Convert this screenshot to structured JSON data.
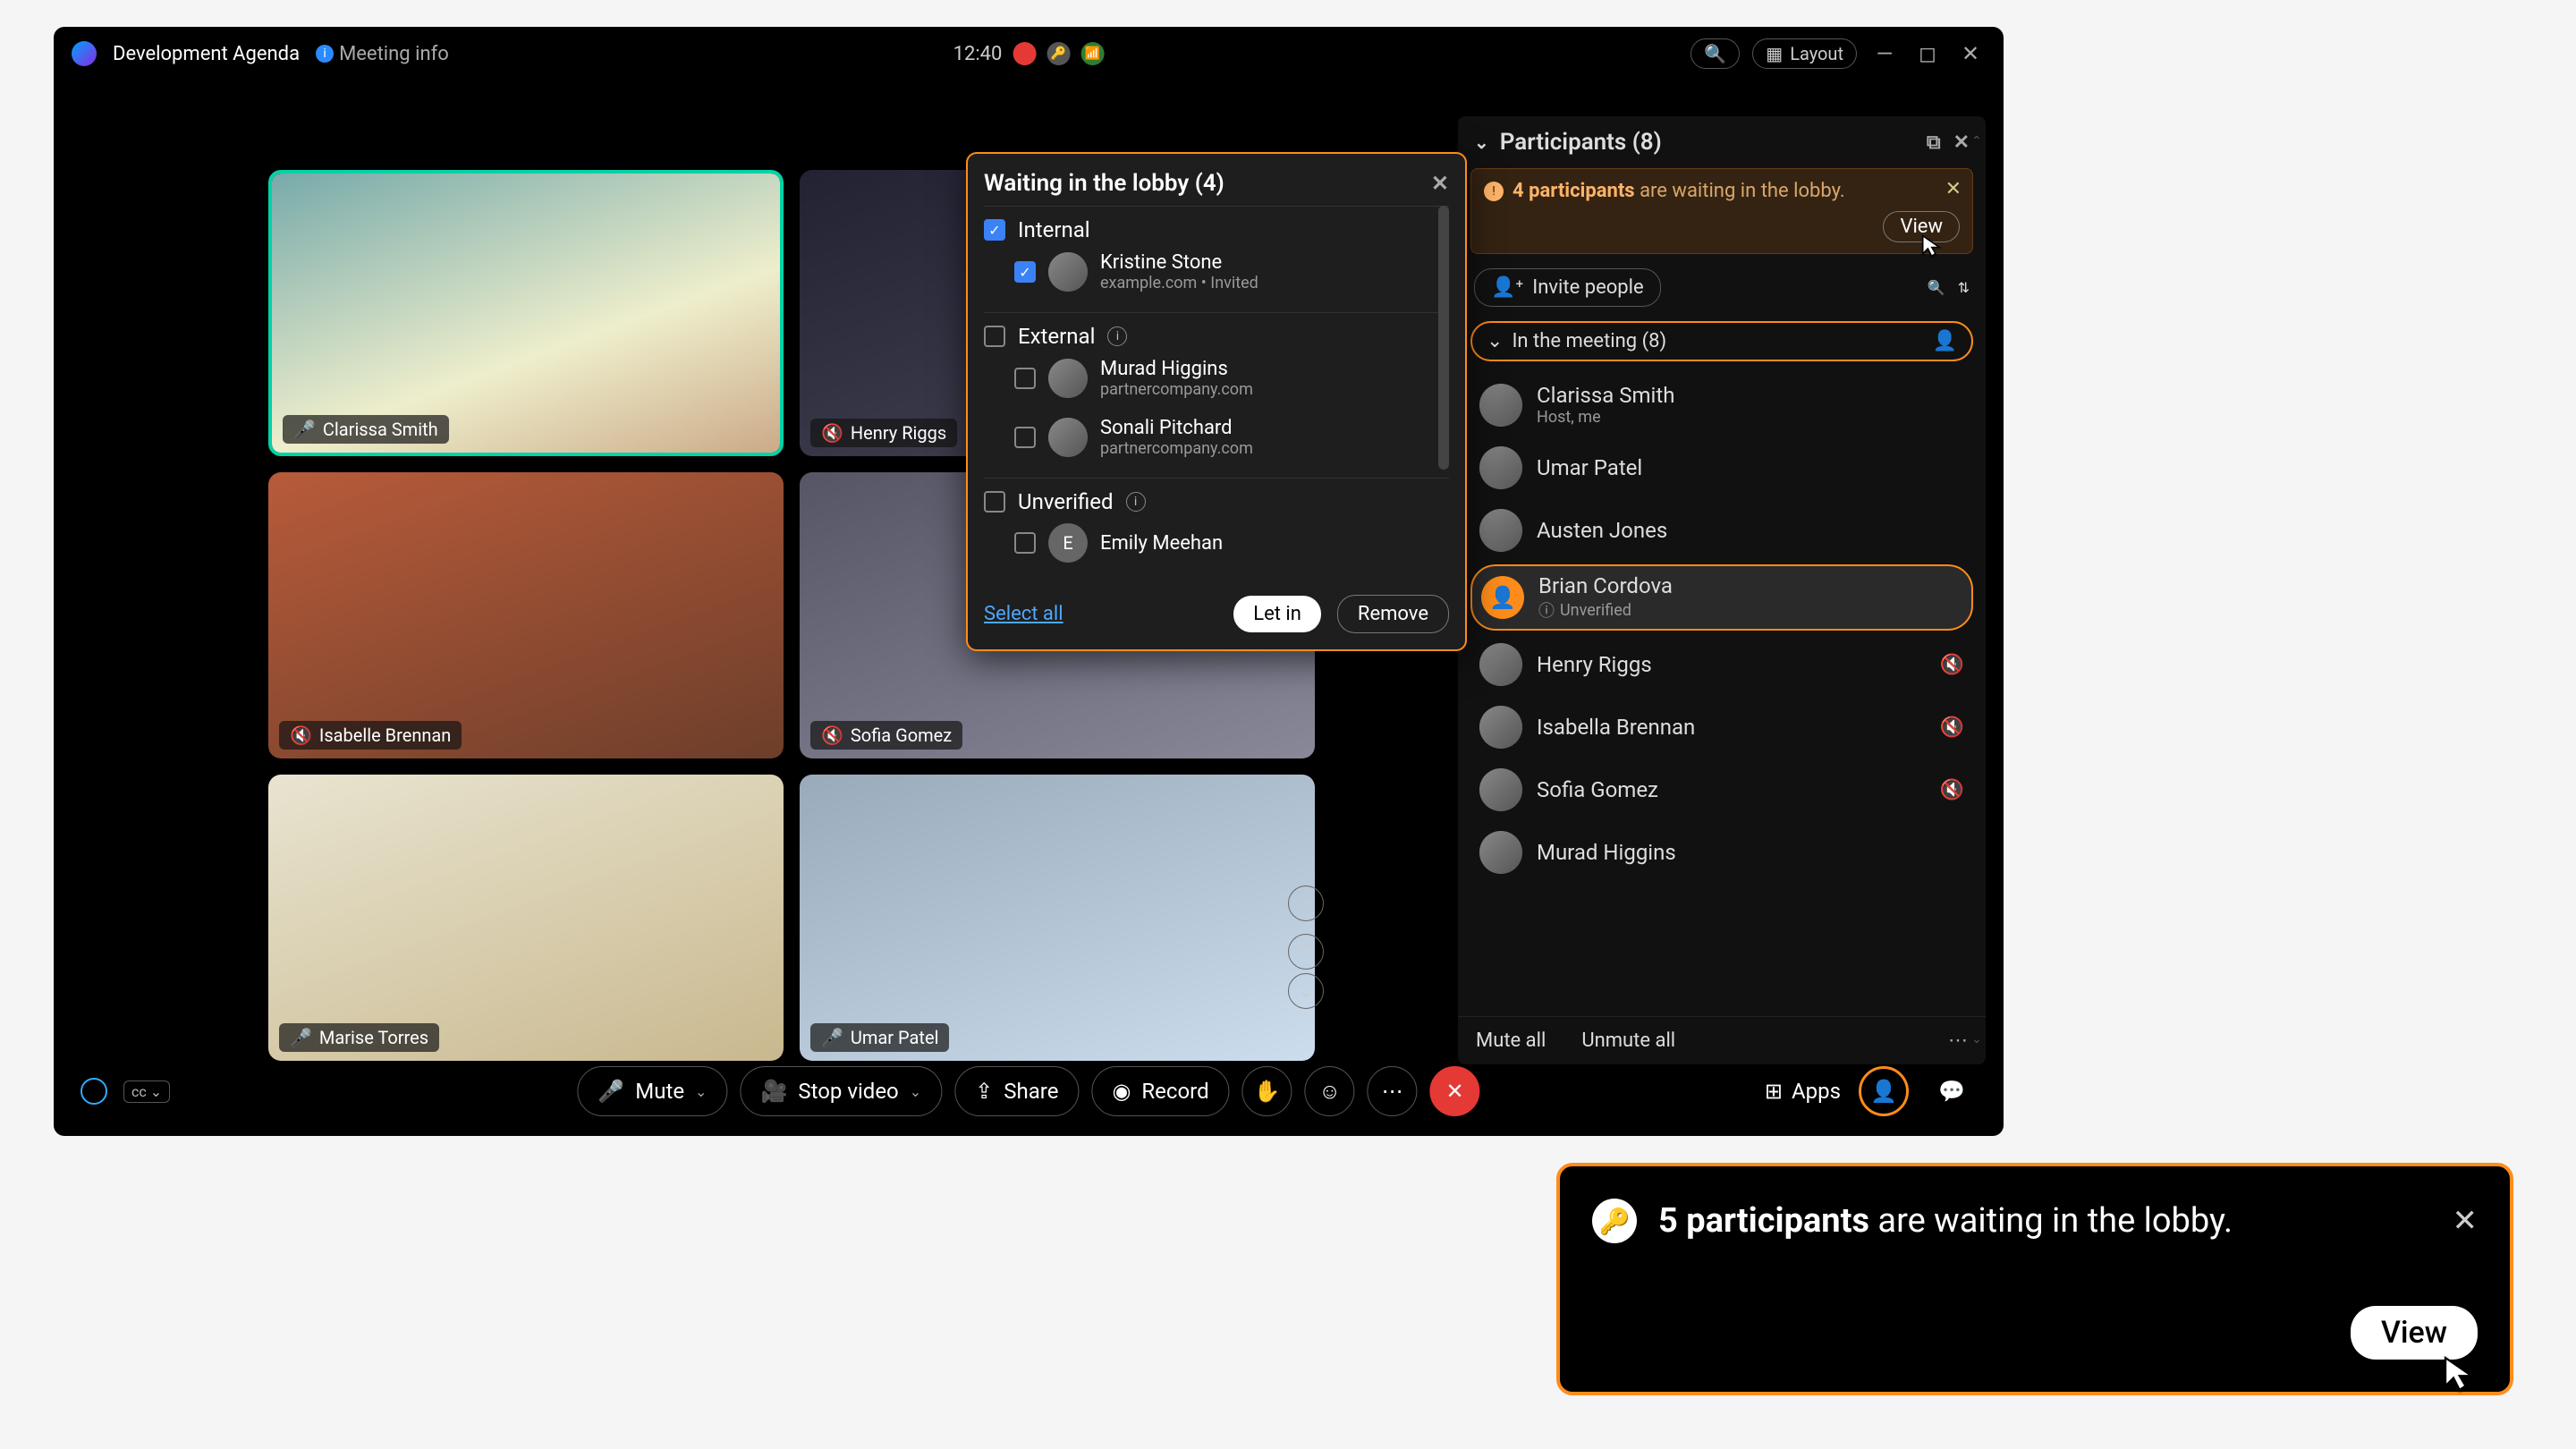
{
  "titlebar": {
    "meeting_name": "Development Agenda",
    "info_label": "Meeting info",
    "clock": "12:40",
    "layout_label": "Layout"
  },
  "tiles": [
    {
      "name": "Clarissa Smith",
      "muted": false,
      "active": true,
      "bg": "linear-gradient(160deg,#7aa,#eec 60%,#ca8)"
    },
    {
      "name": "Henry Riggs",
      "muted": true,
      "active": false,
      "bg": "linear-gradient(160deg,#223,#445)"
    },
    {
      "name": "Isabelle Brennan",
      "muted": true,
      "active": false,
      "bg": "linear-gradient(160deg,#b85b3a,#6d3e2a)"
    },
    {
      "name": "Sofia Gomez",
      "muted": true,
      "active": false,
      "bg": "linear-gradient(160deg,#556,#889)"
    },
    {
      "name": "Marise Torres",
      "muted": false,
      "active": false,
      "bg": "linear-gradient(160deg,#e8e4d0,#c9b88e)"
    },
    {
      "name": "Umar Patel",
      "muted": false,
      "active": false,
      "bg": "linear-gradient(160deg,#9ab,#cde)"
    }
  ],
  "toolbar": {
    "mute": "Mute",
    "video": "Stop video",
    "share": "Share",
    "record": "Record",
    "apps": "Apps"
  },
  "panel": {
    "title": "Participants (8)",
    "alert": {
      "bold": "4 participants",
      "rest": " are waiting in the lobby.",
      "view": "View"
    },
    "invite": "Invite people",
    "section": "In the meeting (8)",
    "items": [
      {
        "name": "Clarissa Smith",
        "sub": "Host, me",
        "muted": false,
        "selected": false,
        "badge": ""
      },
      {
        "name": "Umar Patel",
        "sub": "",
        "muted": false,
        "selected": false,
        "badge": ""
      },
      {
        "name": "Austen Jones",
        "sub": "",
        "muted": false,
        "selected": false,
        "badge": ""
      },
      {
        "name": "Brian Cordova",
        "sub": "Unverified",
        "muted": false,
        "selected": true,
        "badge": "!"
      },
      {
        "name": "Henry Riggs",
        "sub": "",
        "muted": true,
        "selected": false,
        "badge": ""
      },
      {
        "name": "Isabella Brennan",
        "sub": "",
        "muted": true,
        "selected": false,
        "badge": ""
      },
      {
        "name": "Sofia Gomez",
        "sub": "",
        "muted": true,
        "selected": false,
        "badge": ""
      },
      {
        "name": "Murad Higgins",
        "sub": "",
        "muted": false,
        "selected": false,
        "badge": ""
      }
    ],
    "mute_all": "Mute all",
    "unmute_all": "Unmute all"
  },
  "lobby": {
    "title": "Waiting in the lobby (4)",
    "groups": [
      {
        "label": "Internal",
        "checked": true,
        "info": false,
        "people": [
          {
            "name": "Kristine Stone",
            "sub": "example.com • Invited",
            "checked": true,
            "initial": ""
          }
        ]
      },
      {
        "label": "External",
        "checked": false,
        "info": true,
        "people": [
          {
            "name": "Murad Higgins",
            "sub": "partnercompany.com",
            "checked": false,
            "initial": ""
          },
          {
            "name": "Sonali Pitchard",
            "sub": "partnercompany.com",
            "checked": false,
            "initial": ""
          }
        ]
      },
      {
        "label": "Unverified",
        "checked": false,
        "info": true,
        "people": [
          {
            "name": "Emily Meehan",
            "sub": "",
            "checked": false,
            "initial": "E"
          }
        ]
      }
    ],
    "select_all": "Select all",
    "let_in": "Let in",
    "remove": "Remove"
  },
  "toast": {
    "bold": "5 participants",
    "rest": " are waiting in the lobby.",
    "view": "View"
  }
}
